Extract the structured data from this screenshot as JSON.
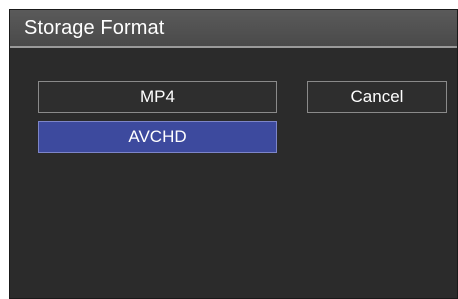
{
  "dialog": {
    "title": "Storage Format",
    "options": [
      {
        "label": "MP4",
        "selected": false
      },
      {
        "label": "AVCHD",
        "selected": true
      }
    ],
    "cancel_label": "Cancel"
  },
  "colors": {
    "background": "#2b2b2b",
    "title_bar": "#4f4f4f",
    "selected": "#3d4a9e",
    "text": "#ffffff"
  }
}
